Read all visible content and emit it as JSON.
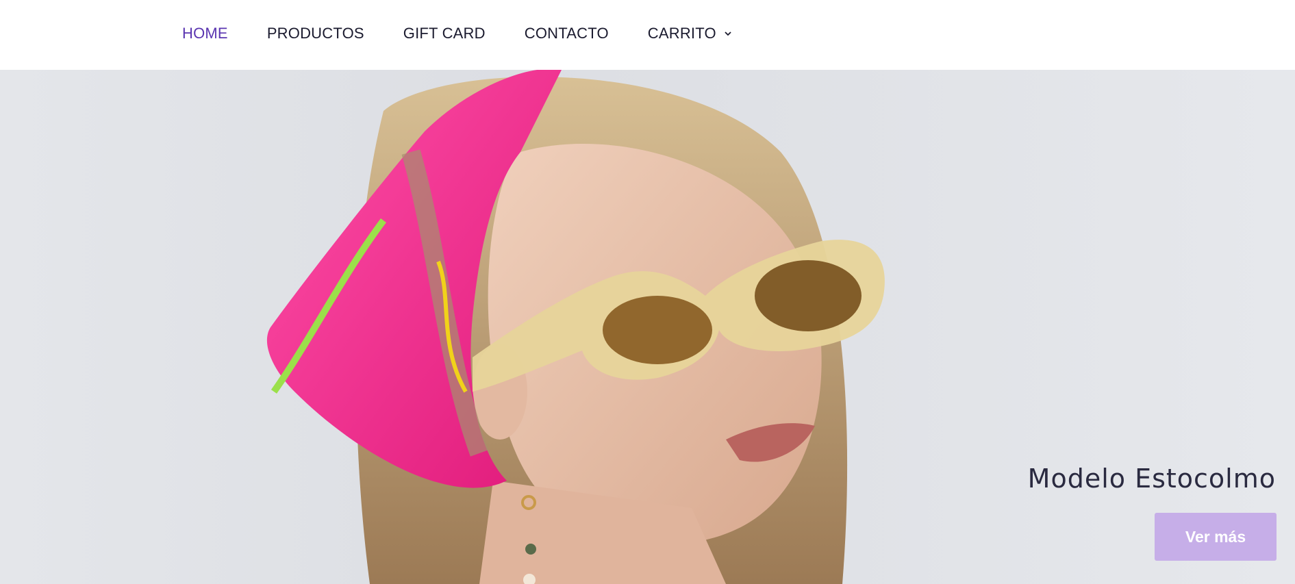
{
  "nav": {
    "items": [
      {
        "label": "HOME",
        "active": true
      },
      {
        "label": "PRODUCTOS",
        "active": false
      },
      {
        "label": "GIFT CARD",
        "active": false
      },
      {
        "label": "CONTACTO",
        "active": false
      },
      {
        "label": "CARRITO",
        "active": false,
        "icon": "chevron-down-icon"
      }
    ]
  },
  "hero": {
    "title": "Modelo Estocolmo",
    "button_label": "Ver más",
    "image_subject": "woman-with-pink-headscarf-and-sunglasses"
  },
  "colors": {
    "accent": "#5a35b0",
    "button_bg": "#c6aee8",
    "nav_text": "#1a1a2e",
    "hero_bg": "#e2e4e8"
  }
}
